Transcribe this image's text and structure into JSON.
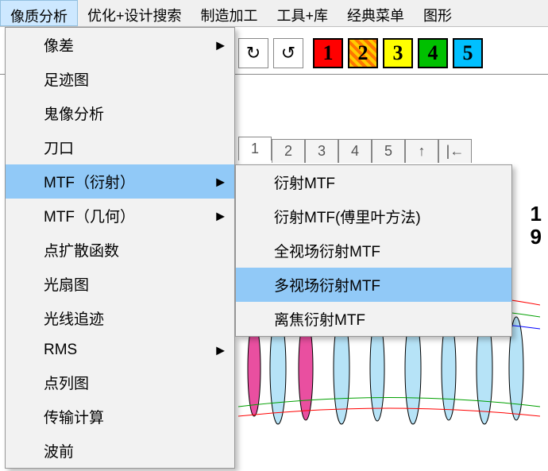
{
  "menubar": {
    "items": [
      {
        "label": "像质分析",
        "active": true
      },
      {
        "label": "优化+设计搜索",
        "active": false
      },
      {
        "label": "制造加工",
        "active": false
      },
      {
        "label": "工具+库",
        "active": false
      },
      {
        "label": "经典菜单",
        "active": false
      },
      {
        "label": "图形",
        "active": false
      }
    ]
  },
  "toolbar": {
    "refresh1": "↻",
    "refresh2": "↺",
    "numbers": [
      {
        "label": "1",
        "bg": "#ff0000"
      },
      {
        "label": "2",
        "bg": "#ffa500"
      },
      {
        "label": "3",
        "bg": "#ffff00"
      },
      {
        "label": "4",
        "bg": "#00c000"
      },
      {
        "label": "5",
        "bg": "#00c0ff"
      }
    ]
  },
  "sub_tabs": [
    "1",
    "2",
    "3",
    "4",
    "5",
    "↑",
    "|←"
  ],
  "side_value": "1\n9",
  "dropdown_main": {
    "items": [
      {
        "label": "像差",
        "has_sub": true,
        "hl": false
      },
      {
        "label": "足迹图",
        "has_sub": false,
        "hl": false
      },
      {
        "label": "鬼像分析",
        "has_sub": false,
        "hl": false
      },
      {
        "label": "刀口",
        "has_sub": false,
        "hl": false
      },
      {
        "label": "MTF（衍射）",
        "has_sub": true,
        "hl": true
      },
      {
        "label": "MTF（几何）",
        "has_sub": true,
        "hl": false
      },
      {
        "label": "点扩散函数",
        "has_sub": false,
        "hl": false
      },
      {
        "label": "光扇图",
        "has_sub": false,
        "hl": false
      },
      {
        "label": "光线追迹",
        "has_sub": false,
        "hl": false
      },
      {
        "label": "RMS",
        "has_sub": true,
        "hl": false
      },
      {
        "label": "点列图",
        "has_sub": false,
        "hl": false
      },
      {
        "label": "传输计算",
        "has_sub": false,
        "hl": false
      },
      {
        "label": "波前",
        "has_sub": false,
        "hl": false
      }
    ]
  },
  "dropdown_sub": {
    "items": [
      {
        "label": "衍射MTF",
        "hl": false
      },
      {
        "label": "衍射MTF(傅里叶方法)",
        "hl": false
      },
      {
        "label": "全视场衍射MTF",
        "hl": false
      },
      {
        "label": "多视场衍射MTF",
        "hl": true
      },
      {
        "label": "离焦衍射MTF",
        "hl": false
      }
    ]
  }
}
